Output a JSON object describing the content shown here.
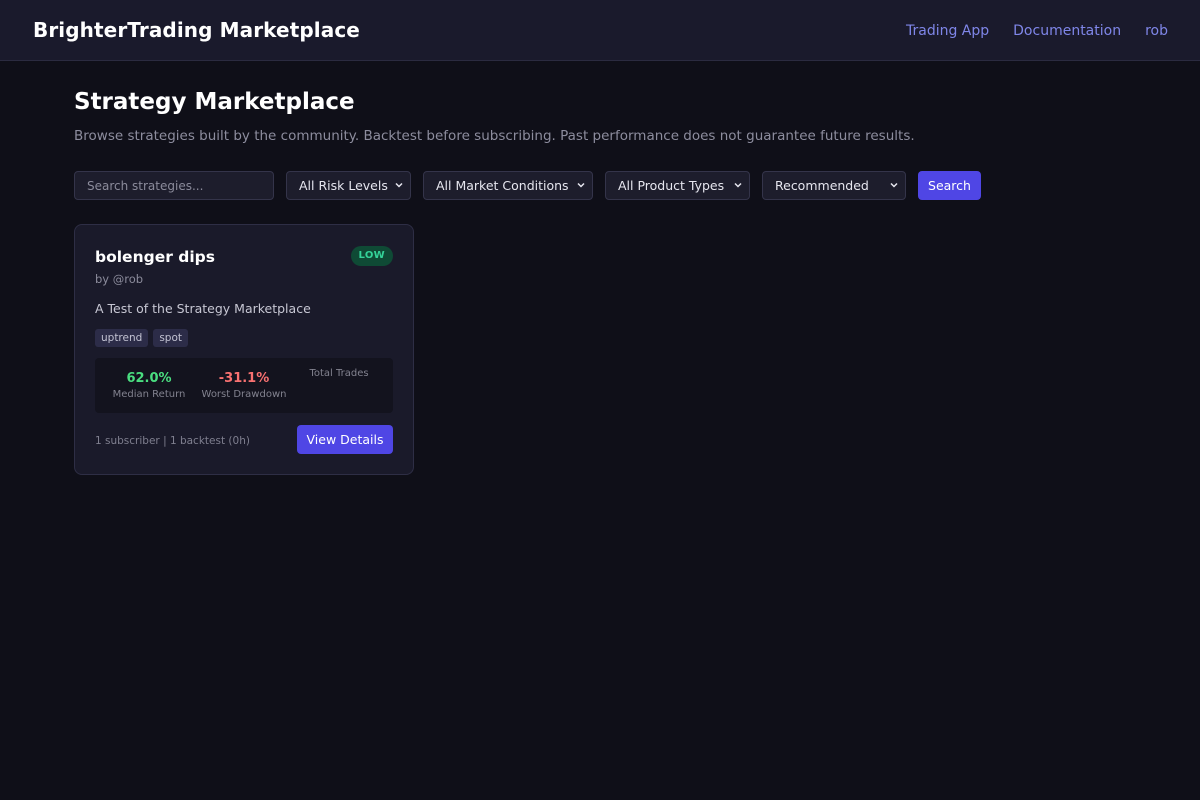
{
  "header": {
    "brand": "BrighterTrading Marketplace",
    "nav": [
      "Trading App",
      "Documentation",
      "rob"
    ]
  },
  "page": {
    "title": "Strategy Marketplace",
    "subtitle": "Browse strategies built by the community. Backtest before subscribing. Past performance does not guarantee future results."
  },
  "filters": {
    "search_placeholder": "Search strategies...",
    "search_value": "",
    "risk": "All Risk Levels",
    "market": "All Market Conditions",
    "product": "All Product Types",
    "sort": "Recommended",
    "search_button": "Search"
  },
  "strategies": [
    {
      "name": "bolenger dips",
      "author": "by @rob",
      "risk": "LOW",
      "description": "A Test of the Strategy Marketplace",
      "tags": [
        "uptrend",
        "spot"
      ],
      "stats": {
        "median_return_value": "62.0%",
        "median_return_label": "Median Return",
        "worst_drawdown_value": "-31.1%",
        "worst_drawdown_label": "Worst Drawdown",
        "total_trades_value": "",
        "total_trades_label": "Total Trades"
      },
      "footer": "1 subscriber | 1 backtest (0h)",
      "button": "View Details"
    }
  ],
  "icons": {
    "select_arrow": "chevron-down-icon"
  },
  "colors": {
    "accent": "#4f46e5",
    "link": "#7f86e8",
    "positive": "#4ade80",
    "negative": "#f87171",
    "risk_low_bg": "#0f4a35",
    "risk_low_text": "#34d399"
  }
}
